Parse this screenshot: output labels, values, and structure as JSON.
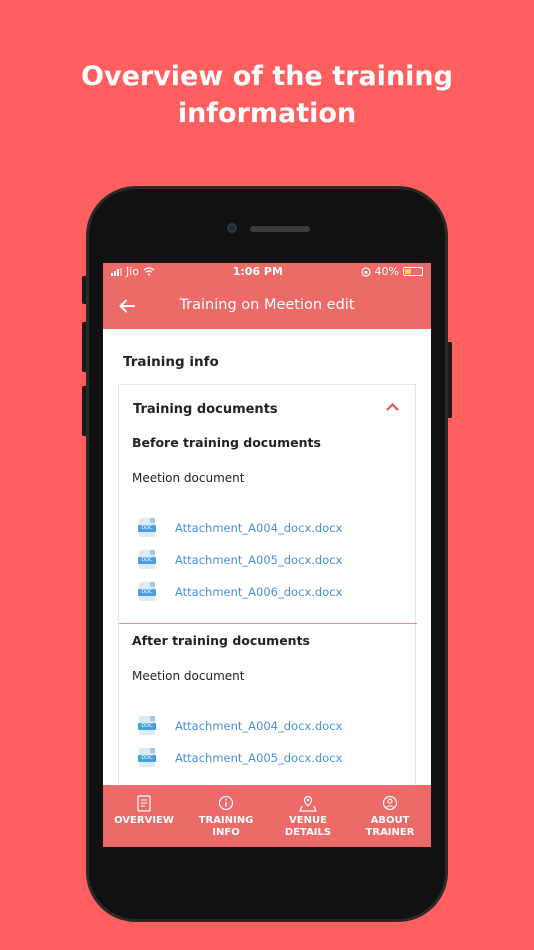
{
  "headline": {
    "line1": "Overview of the training",
    "line2": "information"
  },
  "status_bar": {
    "carrier": "Jio",
    "time": "1:06 PM",
    "battery": "40%",
    "battery_level": 0.4
  },
  "app_bar": {
    "title": "Training on Meetion edit"
  },
  "content": {
    "section_title": "Training info",
    "card_title": "Training documents",
    "before": {
      "heading": "Before training documents",
      "group_label": "Meetion document",
      "attachments": [
        "Attachment_A004_docx.docx",
        "Attachment_A005_docx.docx",
        "Attachment_A006_docx.docx"
      ]
    },
    "after": {
      "heading": "After training documents",
      "group_label": "Meetion document",
      "attachments": [
        "Attachment_A004_docx.docx",
        "Attachment_A005_docx.docx"
      ]
    }
  },
  "bottom_nav": {
    "items": [
      {
        "line1": "OVERVIEW",
        "line2": "",
        "icon": "document-icon"
      },
      {
        "line1": "TRAINING",
        "line2": "INFO",
        "icon": "info-icon"
      },
      {
        "line1": "VENUE DETAILS",
        "line2": "",
        "icon": "map-pin-icon"
      },
      {
        "line1": "ABOUT",
        "line2": "TRAINER",
        "icon": "trainer-icon"
      }
    ]
  },
  "colors": {
    "background": "#FF5F5F",
    "app_bar": "#EC6A68",
    "link": "#4A90D9",
    "accent": "#E0504E"
  }
}
